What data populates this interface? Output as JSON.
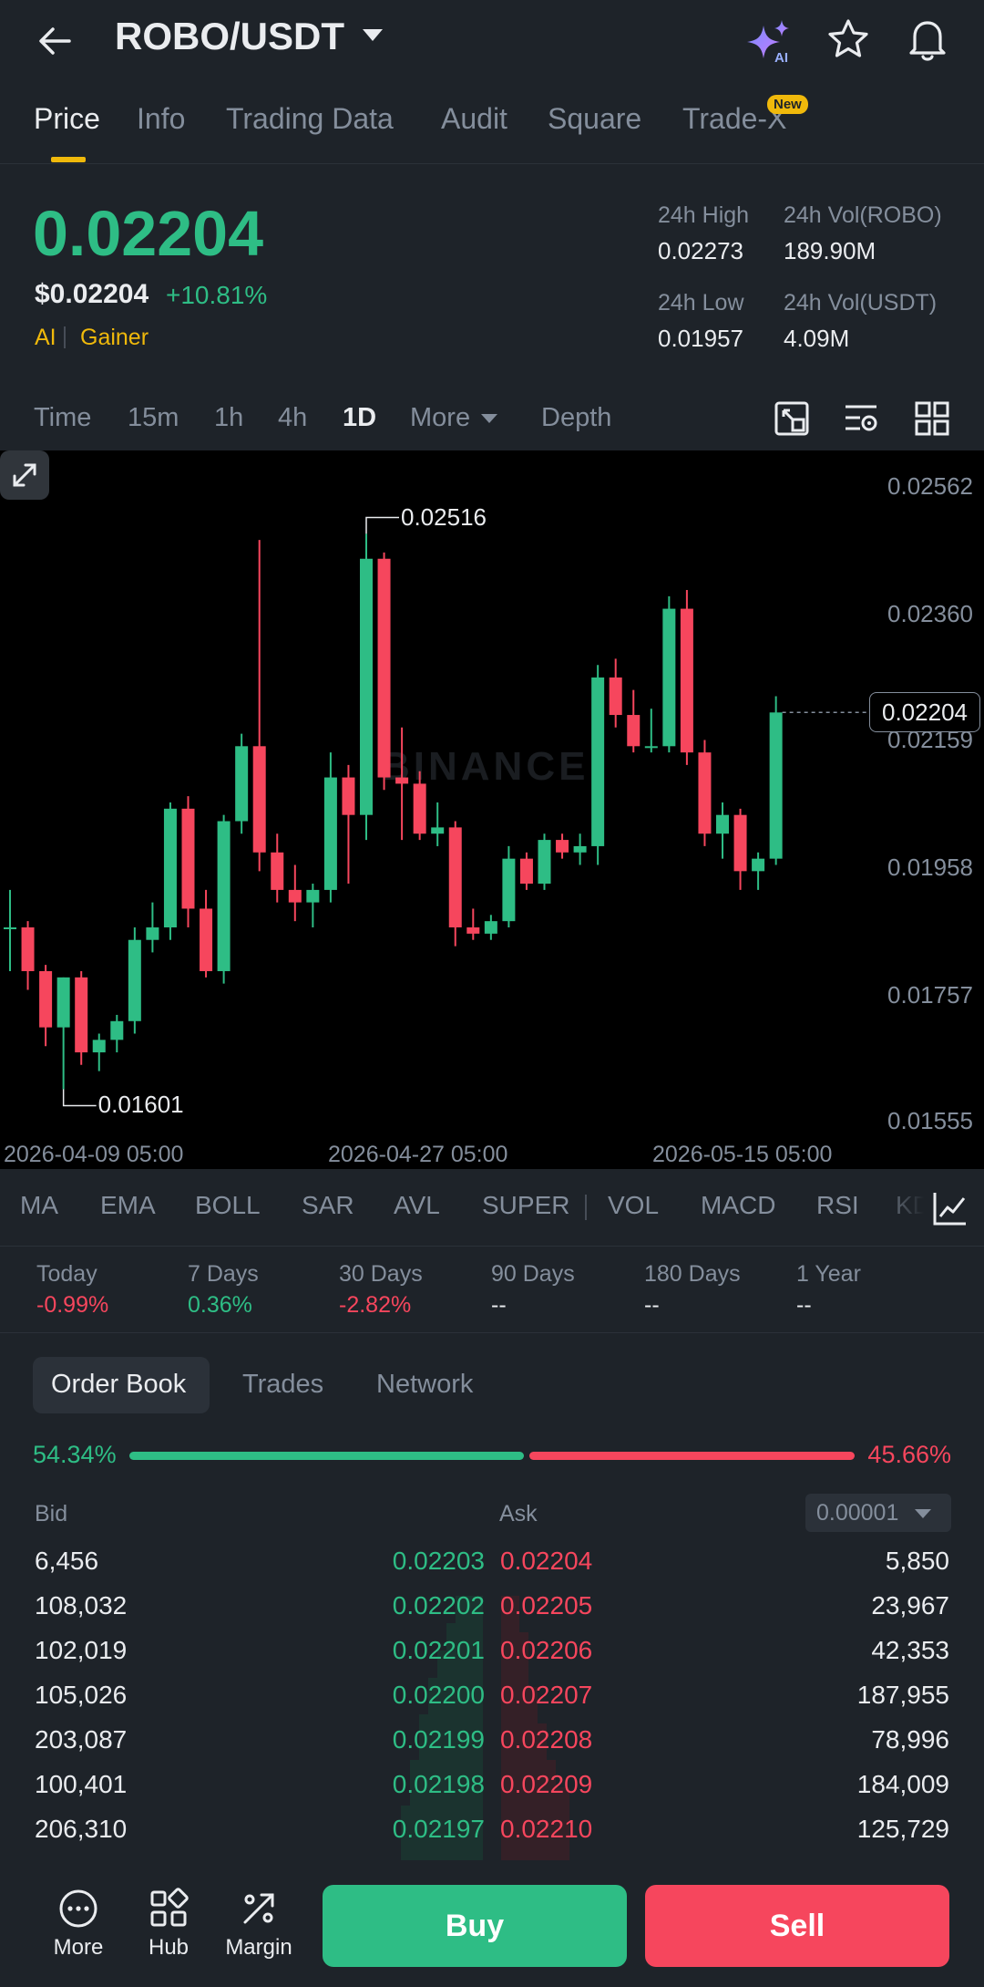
{
  "header": {
    "pair": "ROBO/USDT",
    "icons": [
      "back-arrow-icon",
      "ai-sparkle-icon",
      "star-icon",
      "bell-icon"
    ]
  },
  "tabs": [
    {
      "label": "Price",
      "active": true
    },
    {
      "label": "Info"
    },
    {
      "label": "Trading Data"
    },
    {
      "label": "Audit"
    },
    {
      "label": "Square"
    },
    {
      "label": "Trade-X",
      "badge": "New"
    }
  ],
  "ticker": {
    "last_price": "0.02204",
    "usd_price": "$0.02204",
    "change": "+10.81%",
    "tags": [
      "AI",
      "Gainer"
    ],
    "high_label": "24h High",
    "high": "0.02273",
    "low_label": "24h Low",
    "low": "0.01957",
    "vol_base_label": "24h Vol(ROBO)",
    "vol_base": "189.90M",
    "vol_quote_label": "24h Vol(USDT)",
    "vol_quote": "4.09M"
  },
  "intervals": {
    "items": [
      "Time",
      "15m",
      "1h",
      "4h",
      "1D",
      "More",
      "Depth"
    ],
    "active": "1D"
  },
  "chart": {
    "y_ticks": [
      "0.02562",
      "0.02360",
      "0.02159",
      "0.01958",
      "0.01757",
      "0.01555"
    ],
    "x_ticks": [
      "2026-04-09 05:00",
      "2026-04-27 05:00",
      "2026-05-15 05:00"
    ],
    "current_price_tag": "0.02204",
    "high_marker": "0.02516",
    "low_marker": "0.01601",
    "watermark": "BINANCE"
  },
  "chart_data": {
    "type": "candlestick",
    "ylim": [
      0.01555,
      0.02562
    ],
    "y_ticks": [
      0.02562,
      0.0236,
      0.02159,
      0.01958,
      0.01757,
      0.01555
    ],
    "x_ticks": [
      "2026-04-09 05:00",
      "2026-04-27 05:00",
      "2026-05-15 05:00"
    ],
    "up_color": "#2ebd85",
    "down_color": "#f6465d",
    "candles": [
      {
        "o": 0.0186,
        "h": 0.0192,
        "l": 0.0179,
        "c": 0.0186
      },
      {
        "o": 0.0186,
        "h": 0.0187,
        "l": 0.0176,
        "c": 0.0179
      },
      {
        "o": 0.0179,
        "h": 0.018,
        "l": 0.0167,
        "c": 0.017
      },
      {
        "o": 0.017,
        "h": 0.0178,
        "l": 0.01601,
        "c": 0.0178
      },
      {
        "o": 0.0178,
        "h": 0.0179,
        "l": 0.0164,
        "c": 0.0166
      },
      {
        "o": 0.0166,
        "h": 0.0169,
        "l": 0.0163,
        "c": 0.0168
      },
      {
        "o": 0.0168,
        "h": 0.0172,
        "l": 0.0166,
        "c": 0.0171
      },
      {
        "o": 0.0171,
        "h": 0.0186,
        "l": 0.0169,
        "c": 0.0184
      },
      {
        "o": 0.0184,
        "h": 0.019,
        "l": 0.0182,
        "c": 0.0186
      },
      {
        "o": 0.0186,
        "h": 0.0206,
        "l": 0.0184,
        "c": 0.0205
      },
      {
        "o": 0.0205,
        "h": 0.0207,
        "l": 0.0186,
        "c": 0.0189
      },
      {
        "o": 0.0189,
        "h": 0.0192,
        "l": 0.0178,
        "c": 0.0179
      },
      {
        "o": 0.0179,
        "h": 0.0204,
        "l": 0.0177,
        "c": 0.0203
      },
      {
        "o": 0.0203,
        "h": 0.0217,
        "l": 0.0201,
        "c": 0.0215
      },
      {
        "o": 0.0215,
        "h": 0.0248,
        "l": 0.0195,
        "c": 0.0198
      },
      {
        "o": 0.0198,
        "h": 0.0201,
        "l": 0.019,
        "c": 0.0192
      },
      {
        "o": 0.0192,
        "h": 0.0196,
        "l": 0.0187,
        "c": 0.019
      },
      {
        "o": 0.019,
        "h": 0.0193,
        "l": 0.0186,
        "c": 0.0192
      },
      {
        "o": 0.0192,
        "h": 0.0214,
        "l": 0.019,
        "c": 0.021
      },
      {
        "o": 0.021,
        "h": 0.0212,
        "l": 0.0193,
        "c": 0.0204
      },
      {
        "o": 0.0204,
        "h": 0.0249,
        "l": 0.02,
        "c": 0.0245
      },
      {
        "o": 0.0245,
        "h": 0.0246,
        "l": 0.0208,
        "c": 0.021
      },
      {
        "o": 0.021,
        "h": 0.0218,
        "l": 0.02,
        "c": 0.0209
      },
      {
        "o": 0.0209,
        "h": 0.0211,
        "l": 0.02,
        "c": 0.0201
      },
      {
        "o": 0.0201,
        "h": 0.0206,
        "l": 0.0199,
        "c": 0.0202
      },
      {
        "o": 0.0202,
        "h": 0.0203,
        "l": 0.0183,
        "c": 0.0186
      },
      {
        "o": 0.0186,
        "h": 0.0189,
        "l": 0.0184,
        "c": 0.0185
      },
      {
        "o": 0.0185,
        "h": 0.0188,
        "l": 0.0184,
        "c": 0.0187
      },
      {
        "o": 0.0187,
        "h": 0.0199,
        "l": 0.0186,
        "c": 0.0197
      },
      {
        "o": 0.0197,
        "h": 0.0198,
        "l": 0.0192,
        "c": 0.0193
      },
      {
        "o": 0.0193,
        "h": 0.0201,
        "l": 0.0192,
        "c": 0.02
      },
      {
        "o": 0.02,
        "h": 0.0201,
        "l": 0.0197,
        "c": 0.0198
      },
      {
        "o": 0.0198,
        "h": 0.0201,
        "l": 0.0196,
        "c": 0.0199
      },
      {
        "o": 0.0199,
        "h": 0.0228,
        "l": 0.0196,
        "c": 0.0226
      },
      {
        "o": 0.0226,
        "h": 0.0229,
        "l": 0.0218,
        "c": 0.022
      },
      {
        "o": 0.022,
        "h": 0.0224,
        "l": 0.0214,
        "c": 0.0215
      },
      {
        "o": 0.0215,
        "h": 0.0221,
        "l": 0.0214,
        "c": 0.0215
      },
      {
        "o": 0.0215,
        "h": 0.0239,
        "l": 0.0214,
        "c": 0.0237
      },
      {
        "o": 0.0237,
        "h": 0.024,
        "l": 0.0212,
        "c": 0.0214
      },
      {
        "o": 0.0214,
        "h": 0.0216,
        "l": 0.0199,
        "c": 0.0201
      },
      {
        "o": 0.0201,
        "h": 0.0206,
        "l": 0.0197,
        "c": 0.0204
      },
      {
        "o": 0.0204,
        "h": 0.0205,
        "l": 0.0192,
        "c": 0.0195
      },
      {
        "o": 0.0195,
        "h": 0.0198,
        "l": 0.0192,
        "c": 0.0197
      },
      {
        "o": 0.0197,
        "h": 0.0223,
        "l": 0.0196,
        "c": 0.02204
      }
    ]
  },
  "indicators": [
    "MA",
    "EMA",
    "BOLL",
    "SAR",
    "AVL",
    "SUPER",
    "VOL",
    "MACD",
    "RSI",
    "KD"
  ],
  "performance": [
    {
      "label": "Today",
      "value": "-0.99%",
      "color": "#f6465d"
    },
    {
      "label": "7 Days",
      "value": "0.36%",
      "color": "#2ebd85"
    },
    {
      "label": "30 Days",
      "value": "-2.82%",
      "color": "#f6465d"
    },
    {
      "label": "90 Days",
      "value": "--",
      "color": "#eaecef"
    },
    {
      "label": "180 Days",
      "value": "--",
      "color": "#eaecef"
    },
    {
      "label": "1 Year",
      "value": "--",
      "color": "#eaecef"
    }
  ],
  "orderbook": {
    "tabs": [
      "Order Book",
      "Trades",
      "Network"
    ],
    "bid_pct": "54.34%",
    "ask_pct": "45.66%",
    "bid_ratio": 0.5434,
    "bid_header": "Bid",
    "ask_header": "Ask",
    "precision": "0.00001",
    "rows": [
      {
        "bid_qty": "6,456",
        "bid_px": "0.02203",
        "ask_px": "0.02204",
        "ask_qty": "5,850"
      },
      {
        "bid_qty": "108,032",
        "bid_px": "0.02202",
        "ask_px": "0.02205",
        "ask_qty": "23,967"
      },
      {
        "bid_qty": "102,019",
        "bid_px": "0.02201",
        "ask_px": "0.02206",
        "ask_qty": "42,353"
      },
      {
        "bid_qty": "105,026",
        "bid_px": "0.02200",
        "ask_px": "0.02207",
        "ask_qty": "187,955"
      },
      {
        "bid_qty": "203,087",
        "bid_px": "0.02199",
        "ask_px": "0.02208",
        "ask_qty": "78,996"
      },
      {
        "bid_qty": "100,401",
        "bid_px": "0.02198",
        "ask_px": "0.02209",
        "ask_qty": "184,009"
      },
      {
        "bid_qty": "206,310",
        "bid_px": "0.02197",
        "ask_px": "0.02210",
        "ask_qty": "125,729"
      }
    ]
  },
  "bottom": {
    "more": "More",
    "hub": "Hub",
    "margin": "Margin",
    "buy": "Buy",
    "sell": "Sell"
  }
}
